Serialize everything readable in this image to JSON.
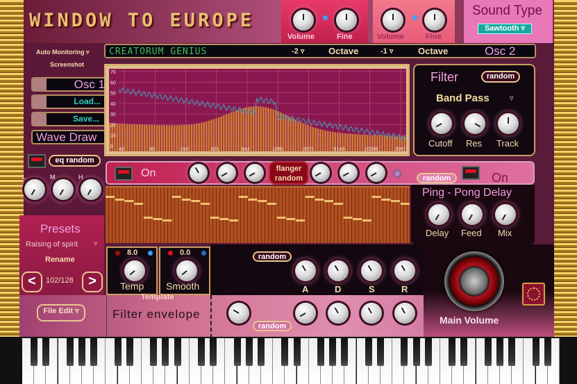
{
  "title": "WINDOW TO EUROPE",
  "osc1_top": {
    "volume_label": "Volume",
    "fine_label": "Fine"
  },
  "osc2_top": {
    "volume_label": "Volume",
    "fine_label": "Fine"
  },
  "sound_type": {
    "label": "Sound Type",
    "value": "Sawtooth ▿"
  },
  "strip": {
    "brand": "CREATORUM GENIUS",
    "octave1_value": "-2 ▿",
    "octave1_label": "Octave",
    "octave2_value": "-1 ▿",
    "octave2_label": "Octave",
    "osc2_label": "Osc 2"
  },
  "left": {
    "auto_monitoring": "Auto Monitoring ▿",
    "screenshot": "Screenshot",
    "osc1": "Osc 1",
    "load": "Load...",
    "save": "Save...",
    "wave_draw": "Wave Draw",
    "eq_random": "eq random",
    "eq_labels": [
      "L",
      "M",
      "H"
    ]
  },
  "chart_data": {
    "type": "area",
    "x_ticks": [
      "40",
      "80",
      "160",
      "321",
      "642",
      "1285",
      "2571",
      "5143",
      "10286",
      "20572"
    ],
    "y_ticks": [
      "0",
      "10",
      "20",
      "30",
      "40",
      "50",
      "60",
      "70"
    ],
    "ylim": [
      0,
      70
    ],
    "grid": true,
    "xscale": "log"
  },
  "filter": {
    "title": "Filter",
    "random": "random",
    "type": "Band Pass",
    "type_arrow": "▿",
    "knobs": [
      "Cutoff",
      "Res",
      "Track"
    ]
  },
  "fx": {
    "on1": "On",
    "flanger_random": "flanger random",
    "random": "random",
    "on2": "On"
  },
  "delay": {
    "title": "Ping - Pong Delay",
    "knobs": [
      "Delay",
      "Feed",
      "Mix"
    ]
  },
  "presets": {
    "title": "Presets",
    "current": "Raising of spirit",
    "arrow": "▿",
    "rename": "Rename",
    "prev": "<",
    "next": ">",
    "counter": "102/128",
    "file_edit": "File Edit ▿"
  },
  "template": {
    "label": "Template",
    "temp_value": "8.0",
    "temp_label": "Temp",
    "smooth_value": "0.0",
    "smooth_label": "Smooth",
    "filter_envelope": "Filter envelope"
  },
  "adsr": {
    "random_top": "random",
    "random_bottom": "random",
    "labels": [
      "A",
      "D",
      "S",
      "R"
    ]
  },
  "main_volume": "Main Volume",
  "colors": {
    "accent_pink": "#f0a0e0",
    "teal": "#30d0c0",
    "gold": "#e8c890"
  }
}
